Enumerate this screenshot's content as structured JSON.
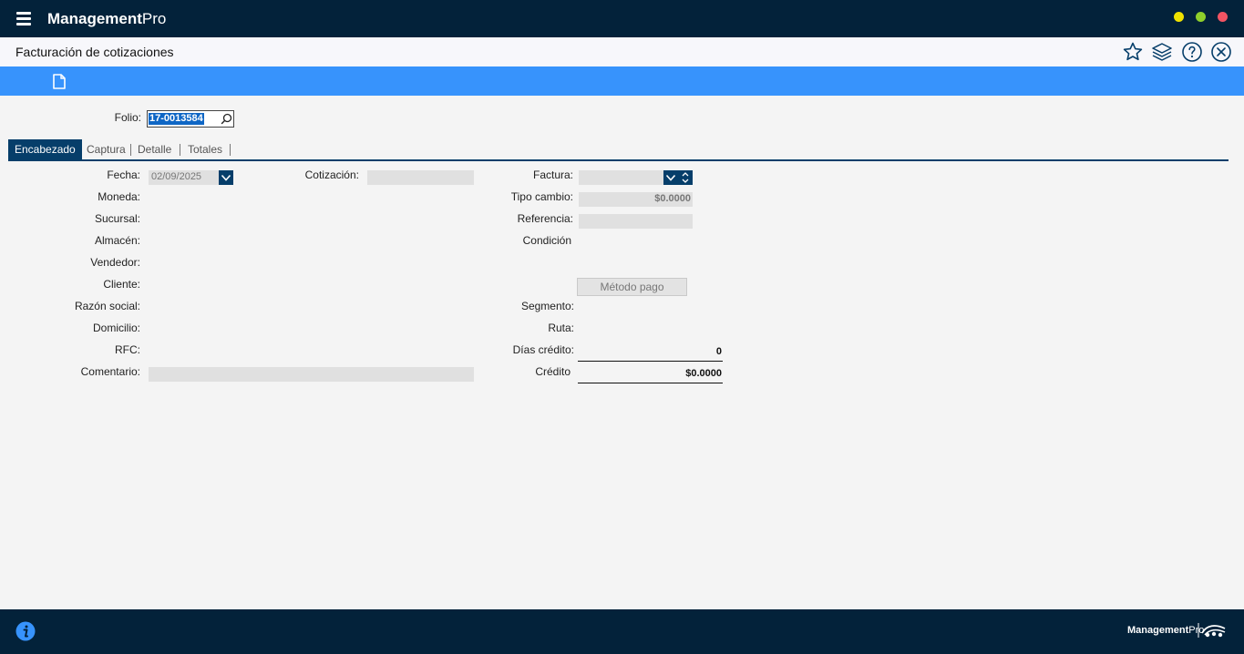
{
  "app": {
    "brand_bold": "Management",
    "brand_light": "Pro",
    "window_dots": [
      "#f0e200",
      "#8fcf2b",
      "#f25463"
    ]
  },
  "header": {
    "title": "Facturación de cotizaciones",
    "icons": [
      "star-icon",
      "layers-icon",
      "help-icon",
      "close-icon"
    ]
  },
  "toolbar": {
    "icons": [
      "document-icon"
    ]
  },
  "folio": {
    "label": "Folio:",
    "value": "17-0013584"
  },
  "tabs": [
    {
      "label": "Encabezado",
      "active": true
    },
    {
      "label": "Captura",
      "active": false
    },
    {
      "label": "Detalle",
      "active": false
    },
    {
      "label": "Totales",
      "active": false
    }
  ],
  "form": {
    "fecha": {
      "label": "Fecha:",
      "value": "02/09/2025"
    },
    "moneda": {
      "label": "Moneda:"
    },
    "sucursal": {
      "label": "Sucursal:"
    },
    "almacen": {
      "label": "Almacén:"
    },
    "vendedor": {
      "label": "Vendedor:"
    },
    "cliente": {
      "label": "Cliente:"
    },
    "razon_social": {
      "label": "Razón social:"
    },
    "domicilio": {
      "label": "Domicilio:"
    },
    "rfc": {
      "label": "RFC:"
    },
    "comentario": {
      "label": "Comentario:",
      "value": ""
    },
    "cotizacion": {
      "label": "Cotización:",
      "value": ""
    },
    "factura": {
      "label": "Factura:",
      "value": ""
    },
    "tipo_cambio": {
      "label": "Tipo cambio:",
      "value": "$0.0000"
    },
    "referencia": {
      "label": "Referencia:",
      "value": ""
    },
    "condicion": {
      "label": "Condición"
    },
    "metodo_pago": {
      "label": "Método pago"
    },
    "segmento": {
      "label": "Segmento:"
    },
    "ruta": {
      "label": "Ruta:"
    },
    "dias_credito": {
      "label": "Días crédito:",
      "value": "0"
    },
    "credito": {
      "label": "Crédito",
      "value": "$0.0000"
    }
  },
  "footer": {
    "brand_bold": "Management",
    "brand_light": "Pro",
    "icons": [
      "info-icon",
      "logo-icon"
    ]
  },
  "colors": {
    "titlebar": "#03223a",
    "toolbar": "#3793fc",
    "tab_active": "#063e6a",
    "selection": "#0e66c5"
  }
}
